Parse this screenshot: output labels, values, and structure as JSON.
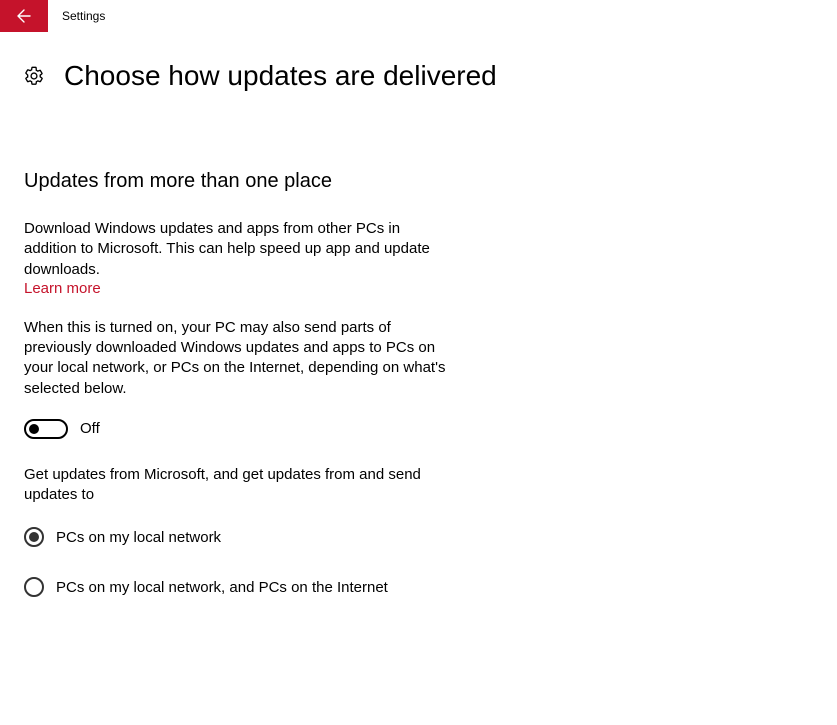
{
  "titlebar": {
    "app_name": "Settings"
  },
  "header": {
    "title": "Choose how updates are delivered"
  },
  "section": {
    "heading": "Updates from more than one place",
    "intro": "Download Windows updates and apps from other PCs in addition to Microsoft. This can help speed up app and update downloads.",
    "learn_more": "Learn more",
    "explain": "When this is turned on, your PC may also send parts of previously downloaded Windows updates and apps to PCs on your local network, or PCs on the Internet, depending on what's selected below.",
    "toggle_state": "Off",
    "sub_heading": "Get updates from Microsoft, and get updates from and send updates to",
    "radios": [
      {
        "label": "PCs on my local network",
        "selected": true
      },
      {
        "label": "PCs on my local network, and PCs on the Internet",
        "selected": false
      }
    ]
  }
}
